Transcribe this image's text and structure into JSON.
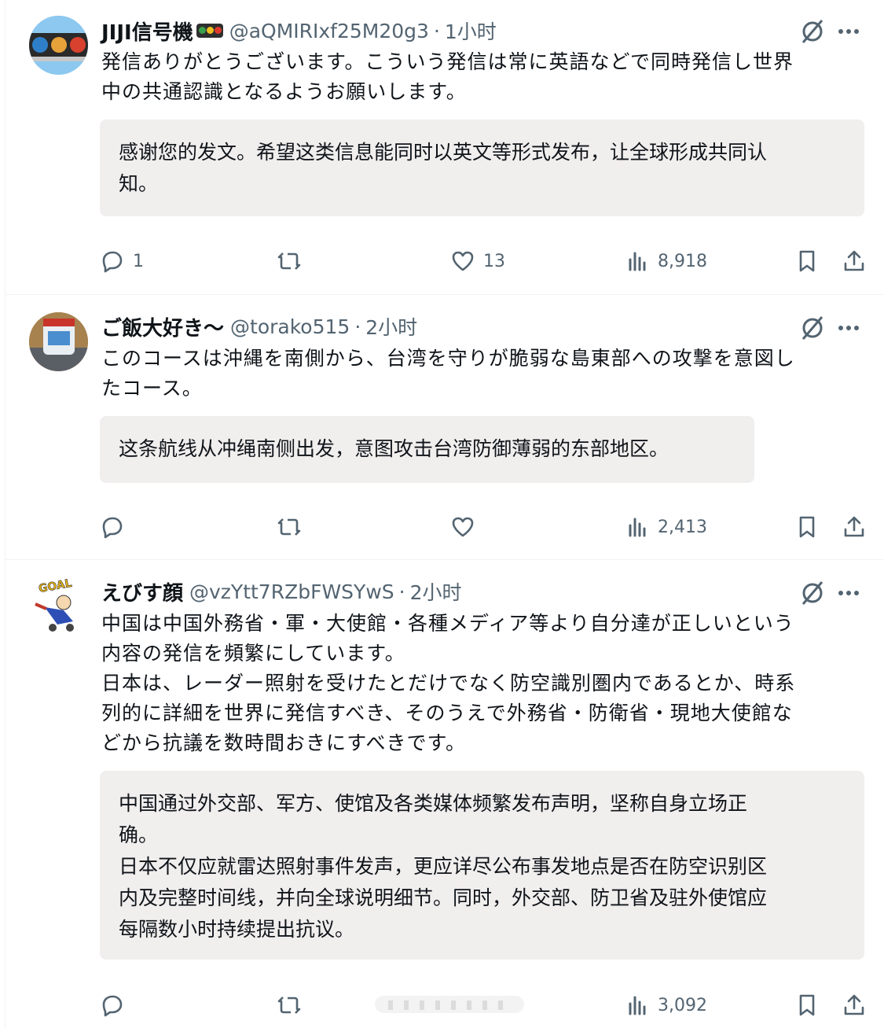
{
  "tweets": [
    {
      "name": "JIJI信号機",
      "handle": "@aQMIRIxf25M20g3",
      "separator": "·",
      "time": "1小时",
      "text": "発信ありがとうございます。こういう発信は常に英語などで同時発信し世界\n中の共通認識となるようお願いします。",
      "translation": "感谢您的发文。希望这类信息能同时以英文等形式发布，让全球形成共同认\n知。",
      "replies": "1",
      "retweets": "",
      "likes": "13",
      "views": "8,918"
    },
    {
      "name": "ご飯大好き〜",
      "handle": "@torako515",
      "separator": "·",
      "time": "2小时",
      "text": "このコースは沖縄を南側から、台湾を守りが脆弱な島東部への攻撃を意図し\nたコース。",
      "translation": "这条航线从冲绳南侧出发，意图攻击台湾防御薄弱的东部地区。",
      "replies": "",
      "retweets": "",
      "likes": "",
      "views": "2,413"
    },
    {
      "name": "えびす顔",
      "handle": "@vzYtt7RZbFWSYwS",
      "separator": "·",
      "time": "2小时",
      "avatar_text": "GOAL",
      "text": "中国は中国外務省・軍・大使館・各種メディア等より自分達が正しいという\n内容の発信を頻繁にしています。\n日本は、レーダー照射を受けたとだけでなく防空識別圏内であるとか、時系\n列的に詳細を世界に発信すべき、そのうえで外務省・防衛省・現地大使館な\nどから抗議を数時間おきにすべきです。",
      "translation": "中国通过外交部、军方、使馆及各类媒体频繁发布声明，坚称自身立场正\n确。\n日本不仅应就雷达照射事件发声，更应详尽公布事发地点是否在防空识别区\n内及完整时间线，并向全球说明细节。同时，外交部、防卫省及驻外使馆应\n每隔数小时持续提出抗议。",
      "replies": "",
      "retweets": "",
      "likes": "",
      "views": "3,092"
    }
  ],
  "icons": {
    "reply": "reply-icon",
    "retweet": "retweet-icon",
    "like": "heart-icon",
    "views": "analytics-icon",
    "bookmark": "bookmark-icon",
    "share": "share-icon",
    "grok": "grok-icon",
    "more": "more-icon"
  },
  "colors": {
    "text": "#0f1419",
    "muted": "#536471",
    "translation_bg": "#f1eeee",
    "divider": "#eff3f4"
  }
}
